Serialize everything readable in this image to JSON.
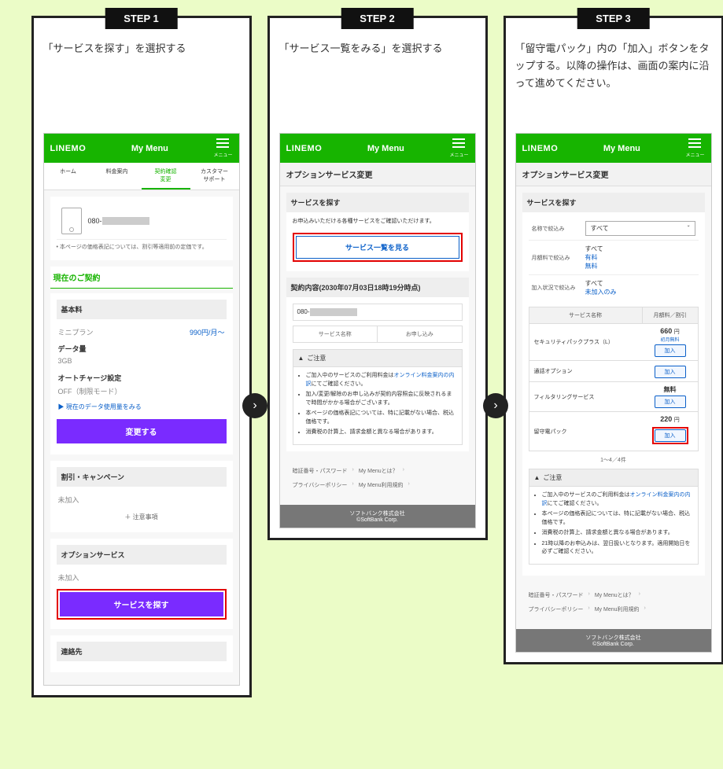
{
  "steps": [
    {
      "badge": "STEP 1",
      "desc": "「サービスを探す」を選択する"
    },
    {
      "badge": "STEP 2",
      "desc": "「サービス一覧をみる」を選択する"
    },
    {
      "badge": "STEP 3",
      "desc": "「留守電パック」内の「加入」ボタンをタップする。以降の操作は、画面の案内に沿って進めてください。"
    }
  ],
  "common": {
    "logo": "LINEMO",
    "mymenu": "My Menu",
    "menu_label": "メニュー",
    "corp_name": "ソフトバンク株式会社",
    "corp_copy": "©SoftBank Corp.",
    "footer1a": "暗証番号・パスワード",
    "footer1b": "My Menuとは？",
    "footer2a": "プライバシーポリシー",
    "footer2b": "My Menu利用規約"
  },
  "step1": {
    "tabs": [
      "ホーム",
      "料金案内",
      "契約確認\n変更",
      "カスタマー\nサポート"
    ],
    "phone_num": "080-",
    "price_note": "本ページの価格表記については、割引等適用前の定価です。",
    "current_contract": "現在のご契約",
    "basic_fee": "基本料",
    "plan": "ミニプラン",
    "plan_price": "990円/月〜",
    "data_label": "データ量",
    "data_val": "3GB",
    "autocharge_label": "オートチャージ設定",
    "autocharge_val": "OFF（制限モード）",
    "data_link": "▶ 現在のデータ使用量をみる",
    "change_btn": "変更する",
    "discount_title": "割引・キャンペーン",
    "not_joined": "未加入",
    "caution_link": "注意事項",
    "option_title": "オプションサービス",
    "find_service_btn": "サービスを探す",
    "contact_title": "連絡先"
  },
  "step2": {
    "page_title": "オプションサービス変更",
    "search_title": "サービスを探す",
    "search_desc": "お申込みいただける各種サービスをご確認いただけます。",
    "list_btn": "サービス一覧を見る",
    "contract_title": "契約内容(2030年07月03日18時19分時点)",
    "phone_num": "080-",
    "col1": "サービス名称",
    "col2": "お申し込み",
    "warn_title": "ご注意",
    "warn_items": [
      "ご加入中のサービスのご利用料金はオンライン料金案内の内訳にてご確認ください。",
      "加入/変更/解除のお申し込みが契約内容照会に反映されるまで時間がかかる場合がございます。",
      "本ページの価格表記については、特に記載がない場合、税込価格です。",
      "消費税の計算上、請求金額と異なる場合があります。"
    ],
    "inline_link": "オンライン料金案内の内訳"
  },
  "step3": {
    "page_title": "オプションサービス変更",
    "search_title": "サービスを探す",
    "filter_name_label": "名称で絞込み",
    "filter_name_val": "すべて",
    "filter_fee_label": "月額料で絞込み",
    "filter_fee_opts": [
      "すべて",
      "有料",
      "無料"
    ],
    "filter_status_label": "加入状況で絞込み",
    "filter_status_opts": [
      "すべて",
      "未加入のみ"
    ],
    "tbl_col1": "サービス名称",
    "tbl_col2": "月額料／割引",
    "rows": [
      {
        "name": "セキュリティパックプラス（L）",
        "price": "660",
        "unit": "円",
        "note": "初月無料",
        "btn": "加入"
      },
      {
        "name": "通話オプション",
        "price": "",
        "unit": "",
        "note": "",
        "btn": "加入"
      },
      {
        "name": "フィルタリングサービス",
        "price": "無料",
        "unit": "",
        "note": "",
        "btn": "加入"
      },
      {
        "name": "留守電パック",
        "price": "220",
        "unit": "円",
        "note": "",
        "btn": "加入",
        "highlight": true
      }
    ],
    "pager": "1～4／4件",
    "warn_title": "ご注意",
    "warn_items": [
      "ご加入中のサービスのご利用料金はオンライン料金案内の内訳にてご確認ください。",
      "本ページの価格表記については、特に記載がない場合、税込価格です。",
      "消費税の計算上、請求金額と異なる場合があります。",
      "21時以降のお申込みは、翌日扱いとなります。適用開始日を必ずご確認ください。"
    ],
    "inline_link": "オンライン料金案内の内訳"
  }
}
